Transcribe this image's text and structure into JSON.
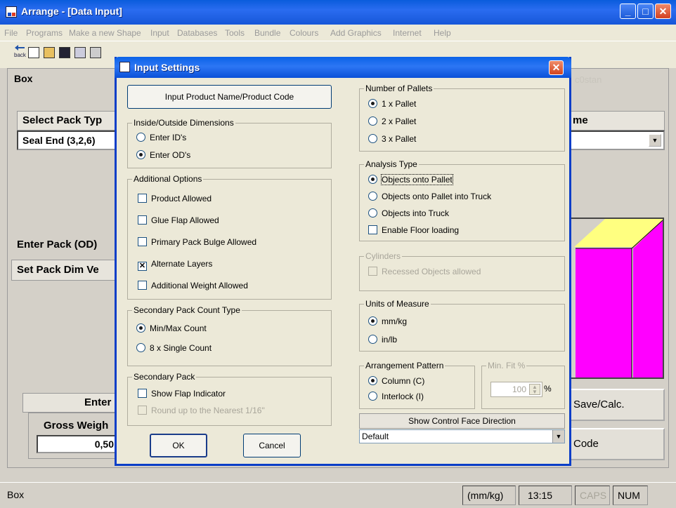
{
  "window": {
    "title": "Arrange - [Data Input]",
    "min": "_",
    "max": "□",
    "close": "✕"
  },
  "menu": [
    "File",
    "Programs",
    "Make a new Shape",
    "Input",
    "Databases",
    "Tools",
    "Bundle",
    "Colours",
    "Add Graphics",
    "Internet",
    "Help"
  ],
  "toolbar": {
    "back_label": "back"
  },
  "background": {
    "box_label": "Box",
    "select_pack_type": "Select Pack Typ",
    "pack_type_value": "Seal End (3,2,6)",
    "name_header": "me",
    "enter_pack": "Enter Pack (OD)",
    "set_pack_dim": "Set Pack Dim Ve",
    "enter_header": "Enter",
    "gross_weight": "Gross Weigh",
    "gross_value": "0,50",
    "save_calc": "Save/Calc.",
    "code_btn": "Code",
    "faint_text": "c0stan"
  },
  "status": {
    "left": "Box",
    "units": "(mm/kg)",
    "time": "13:15",
    "caps": "CAPS",
    "num": "NUM"
  },
  "dialog": {
    "title": "Input Settings",
    "close": "✕",
    "input_product_btn": "Input Product Name/Product Code",
    "inside_outside": {
      "legend": "Inside/Outside Dimensions",
      "options": [
        "Enter ID's",
        "Enter OD's"
      ],
      "selected": 1
    },
    "additional": {
      "legend": "Additional Options",
      "options": [
        "Product Allowed",
        "Glue Flap Allowed",
        "Primary Pack Bulge Allowed",
        "Alternate Layers",
        "Additional Weight Allowed"
      ],
      "checked": [
        false,
        false,
        false,
        true,
        false
      ]
    },
    "secondary_count": {
      "legend": "Secondary Pack Count Type",
      "options": [
        "Min/Max Count",
        "8 x Single Count"
      ],
      "selected": 0
    },
    "secondary_pack": {
      "legend": "Secondary Pack",
      "options": [
        "Show Flap Indicator",
        "Round up to the Nearest 1/16\""
      ]
    },
    "ok": "OK",
    "cancel": "Cancel",
    "pallets": {
      "legend": "Number of Pallets",
      "options": [
        "1 x Pallet",
        "2 x Pallet",
        "3 x Pallet"
      ],
      "selected": 0
    },
    "analysis": {
      "legend": "Analysis Type",
      "options": [
        "Objects onto Pallet",
        "Objects onto Pallet into Truck",
        "Objects into Truck"
      ],
      "selected": 0,
      "floor": "Enable Floor loading"
    },
    "cylinders": {
      "legend": "Cylinders",
      "option": "Recessed Objects allowed"
    },
    "units": {
      "legend": "Units of Measure",
      "options": [
        "mm/kg",
        "in/lb"
      ],
      "selected": 0
    },
    "pattern": {
      "legend": "Arrangement Pattern",
      "options": [
        "Column (C)",
        "Interlock (I)"
      ],
      "selected": 0
    },
    "minfit": {
      "legend": "Min. Fit %",
      "value": "100",
      "suffix": "%"
    },
    "control_face": {
      "label": "Show Control Face Direction",
      "value": "Default"
    }
  },
  "colors": {
    "titlebar": "#0a5cdc",
    "cube_top": "#ffff80",
    "cube_side": "#ff00ff"
  }
}
